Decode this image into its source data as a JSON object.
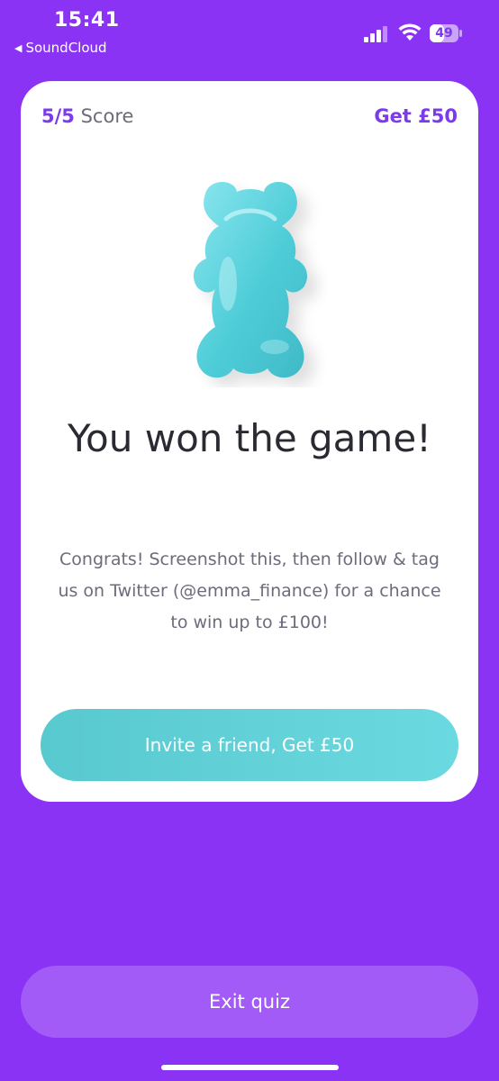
{
  "status_bar": {
    "time": "15:41",
    "back_app": "SoundCloud",
    "battery": "49"
  },
  "card": {
    "score_value": "5/5",
    "score_label": "Score",
    "reward_label": "Get £50",
    "illustration": "gummy-bear-icon",
    "title": "You won the game!",
    "message": "Congrats! Screenshot this, then follow & tag us on Twitter (@emma_finance) for a chance to win up to £100!",
    "invite_button": "Invite a friend, Get £50"
  },
  "exit_button": "Exit quiz",
  "colors": {
    "background": "#8a33f5",
    "accent": "#7c3aed",
    "teal": "#5fd0d8",
    "exit_button": "#a35bf8"
  }
}
